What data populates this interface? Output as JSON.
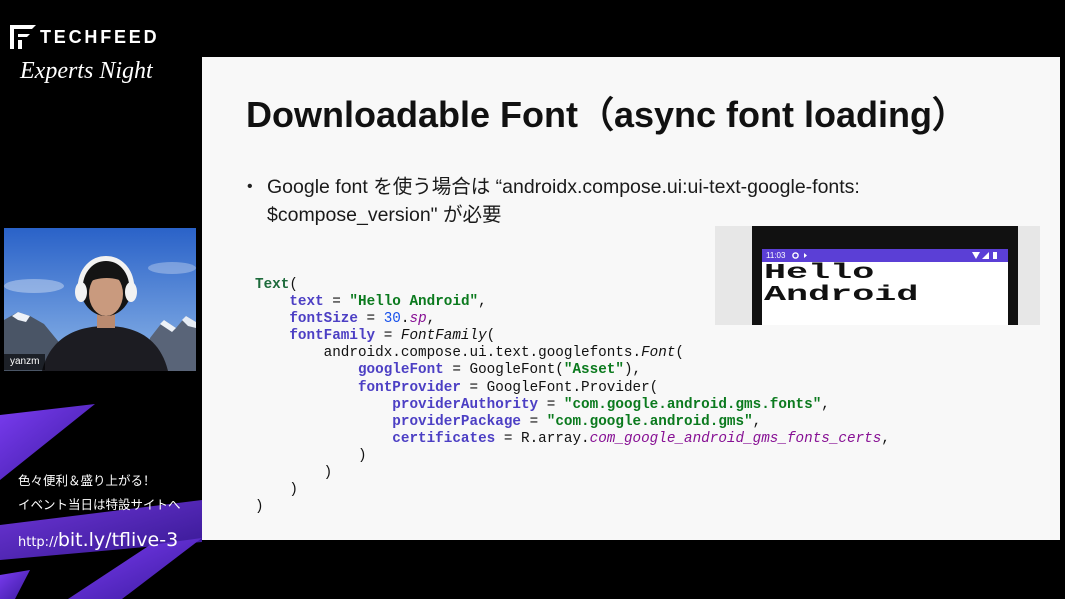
{
  "brand": {
    "name": "TECHFEED",
    "subtitle": "Experts Night",
    "logo_icon": "techfeed-logo-icon"
  },
  "webcam": {
    "speaker_name": "yanzm"
  },
  "promo": {
    "line1": "色々便利＆盛り上がる！",
    "line2": "イベント当日は特設サイトへ",
    "url_prefix": "http://",
    "url_main": "bit.ly/tflive-3",
    "accent_colors": [
      "#7a3cf0",
      "#3b1aa0"
    ]
  },
  "slide": {
    "title": "Downloadable Font（async font loading）",
    "bullet": {
      "marker": "•",
      "lines": [
        "Google font を使う場合は “androidx.compose.ui:ui-text-google-fonts:",
        "$compose_version\" が必要"
      ]
    },
    "code": {
      "palette": {
        "fn": "#1e6b3c",
        "param": "#4c3fc4",
        "plain": "#111111",
        "str": "#0b7a1e",
        "num": "#1750eb",
        "ext": "#871094",
        "call": "#111111"
      },
      "lines": [
        [
          {
            "t": "Text",
            "k": "fn"
          },
          {
            "t": "(",
            "k": "plain"
          }
        ],
        [
          {
            "t": "    ",
            "k": "plain"
          },
          {
            "t": "text",
            "k": "param"
          },
          {
            "t": " = ",
            "k": "plain"
          },
          {
            "t": "\"Hello Android\"",
            "k": "str"
          },
          {
            "t": ",",
            "k": "plain"
          }
        ],
        [
          {
            "t": "    ",
            "k": "plain"
          },
          {
            "t": "fontSize",
            "k": "param"
          },
          {
            "t": " = ",
            "k": "plain"
          },
          {
            "t": "30",
            "k": "num"
          },
          {
            "t": ".",
            "k": "plain"
          },
          {
            "t": "sp",
            "k": "ext"
          },
          {
            "t": ",",
            "k": "plain"
          }
        ],
        [
          {
            "t": "    ",
            "k": "plain"
          },
          {
            "t": "fontFamily",
            "k": "param"
          },
          {
            "t": " = ",
            "k": "plain"
          },
          {
            "t": "FontFamily",
            "k": "call"
          },
          {
            "t": "(",
            "k": "plain"
          }
        ],
        [
          {
            "t": "        androidx.compose.ui.text.googlefonts.",
            "k": "plain"
          },
          {
            "t": "Font",
            "k": "call"
          },
          {
            "t": "(",
            "k": "plain"
          }
        ],
        [
          {
            "t": "            ",
            "k": "plain"
          },
          {
            "t": "googleFont",
            "k": "param"
          },
          {
            "t": " = GoogleFont(",
            "k": "plain"
          },
          {
            "t": "\"Asset\"",
            "k": "str"
          },
          {
            "t": "),",
            "k": "plain"
          }
        ],
        [
          {
            "t": "            ",
            "k": "plain"
          },
          {
            "t": "fontProvider",
            "k": "param"
          },
          {
            "t": " = GoogleFont.Provider(",
            "k": "plain"
          }
        ],
        [
          {
            "t": "                ",
            "k": "plain"
          },
          {
            "t": "providerAuthority",
            "k": "param"
          },
          {
            "t": " = ",
            "k": "plain"
          },
          {
            "t": "\"com.google.android.gms.fonts\"",
            "k": "str"
          },
          {
            "t": ",",
            "k": "plain"
          }
        ],
        [
          {
            "t": "                ",
            "k": "plain"
          },
          {
            "t": "providerPackage",
            "k": "param"
          },
          {
            "t": " = ",
            "k": "plain"
          },
          {
            "t": "\"com.google.android.gms\"",
            "k": "str"
          },
          {
            "t": ",",
            "k": "plain"
          }
        ],
        [
          {
            "t": "                ",
            "k": "plain"
          },
          {
            "t": "certificates",
            "k": "param"
          },
          {
            "t": " = R.array.",
            "k": "plain"
          },
          {
            "t": "com_google_android_gms_fonts_certs",
            "k": "ext"
          },
          {
            "t": ",",
            "k": "plain"
          }
        ],
        [
          {
            "t": "            )",
            "k": "plain"
          }
        ],
        [
          {
            "t": "        )",
            "k": "plain"
          }
        ],
        [
          {
            "t": "    )",
            "k": "plain"
          }
        ],
        [
          {
            "t": ")",
            "k": "plain"
          }
        ]
      ]
    },
    "phone_preview": {
      "status_time": "11:03",
      "status_bar_color": "#5b3fd6",
      "status_icons_left": [
        "settings-icon",
        "sync-icon"
      ],
      "status_icons_right": [
        "wifi-icon",
        "signal-icon",
        "battery-icon"
      ],
      "text_lines": [
        "Hello",
        "Android"
      ]
    }
  }
}
